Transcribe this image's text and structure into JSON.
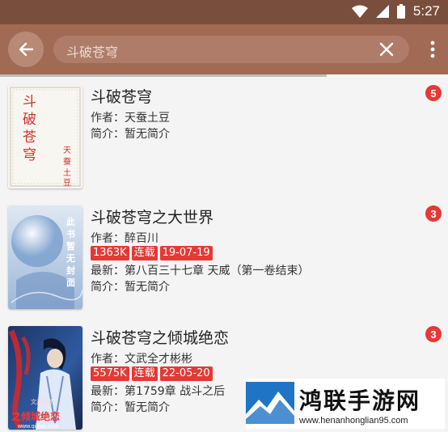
{
  "status_bar": {
    "time": "5:27",
    "icons": [
      "wifi-icon",
      "signal-icon",
      "battery-icon"
    ]
  },
  "toolbar": {
    "search_text": "斗破苍穹",
    "back_icon": "arrow-left-icon",
    "clear_icon": "close-icon",
    "menu_icon": "more-vert-icon"
  },
  "colors": {
    "status_bar": "#7a4e3c",
    "toolbar": "#a06a54",
    "badge": "#e53935"
  },
  "books": [
    {
      "title": "斗破苍穹",
      "author": "作者：天蚕土豆",
      "intro": "简介：暂无简介",
      "badge": "5",
      "cover_title": "斗破苍穹",
      "cover_author": "天蚕土豆"
    },
    {
      "title": "斗破苍穹之大世界",
      "author": "作者：醉百川",
      "tags": [
        "1363K",
        "连载",
        "19-07-19"
      ],
      "latest": "最新：第八百三十七章 天威（第一卷结束）",
      "intro": "简介：暂无简介",
      "badge": "3",
      "cover_text": "此书暂无封面"
    },
    {
      "title": "斗破苍穹之倾城绝恋",
      "author": "作者：文武全才彬彬",
      "tags": [
        "5575K",
        "连载",
        "22-05-20"
      ],
      "latest": "最新：第1759章 战斗之后",
      "intro": "简介：暂无简介",
      "badge": "3",
      "cover_site": "www.qidian.com",
      "cover_title": "之倾城绝恋"
    }
  ],
  "watermark": {
    "name": "鸿联手游网",
    "url": "www.henanhonglian95.com"
  }
}
